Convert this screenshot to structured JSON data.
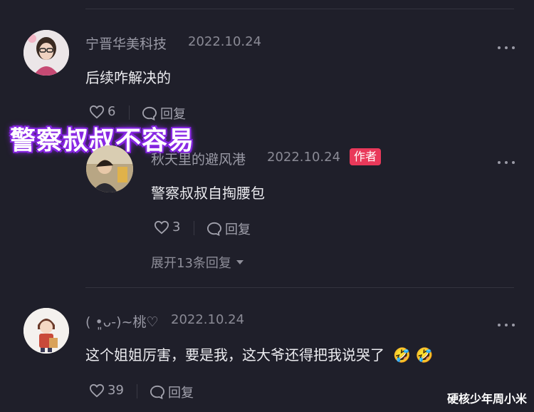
{
  "comments": [
    {
      "username": "宁晋华美科技",
      "date": "2022.10.24",
      "text": "后续咋解决的",
      "likes": "6",
      "reply_label": "回复"
    },
    {
      "username": "秋天里的避风港",
      "date": "2022.10.24",
      "badge": "作者",
      "text": "警察叔叔自掏腰包",
      "likes": "3",
      "reply_label": "回复",
      "expand_label": "展开13条回复"
    },
    {
      "username": "( •͈ᴗ-)~桃♡",
      "date": "2022.10.24",
      "text": "这个姐姐厉害，要是我，这大爷还得把我说哭了",
      "emojis": "🤣 🤣",
      "likes": "39",
      "reply_label": "回复"
    }
  ],
  "overlay_caption": "警察叔叔不容易",
  "watermark": "硬核少年周小米",
  "colors": {
    "background": "#1f1f2a",
    "author_badge": "#e9395a",
    "caption_glow": "#8a2be2"
  }
}
